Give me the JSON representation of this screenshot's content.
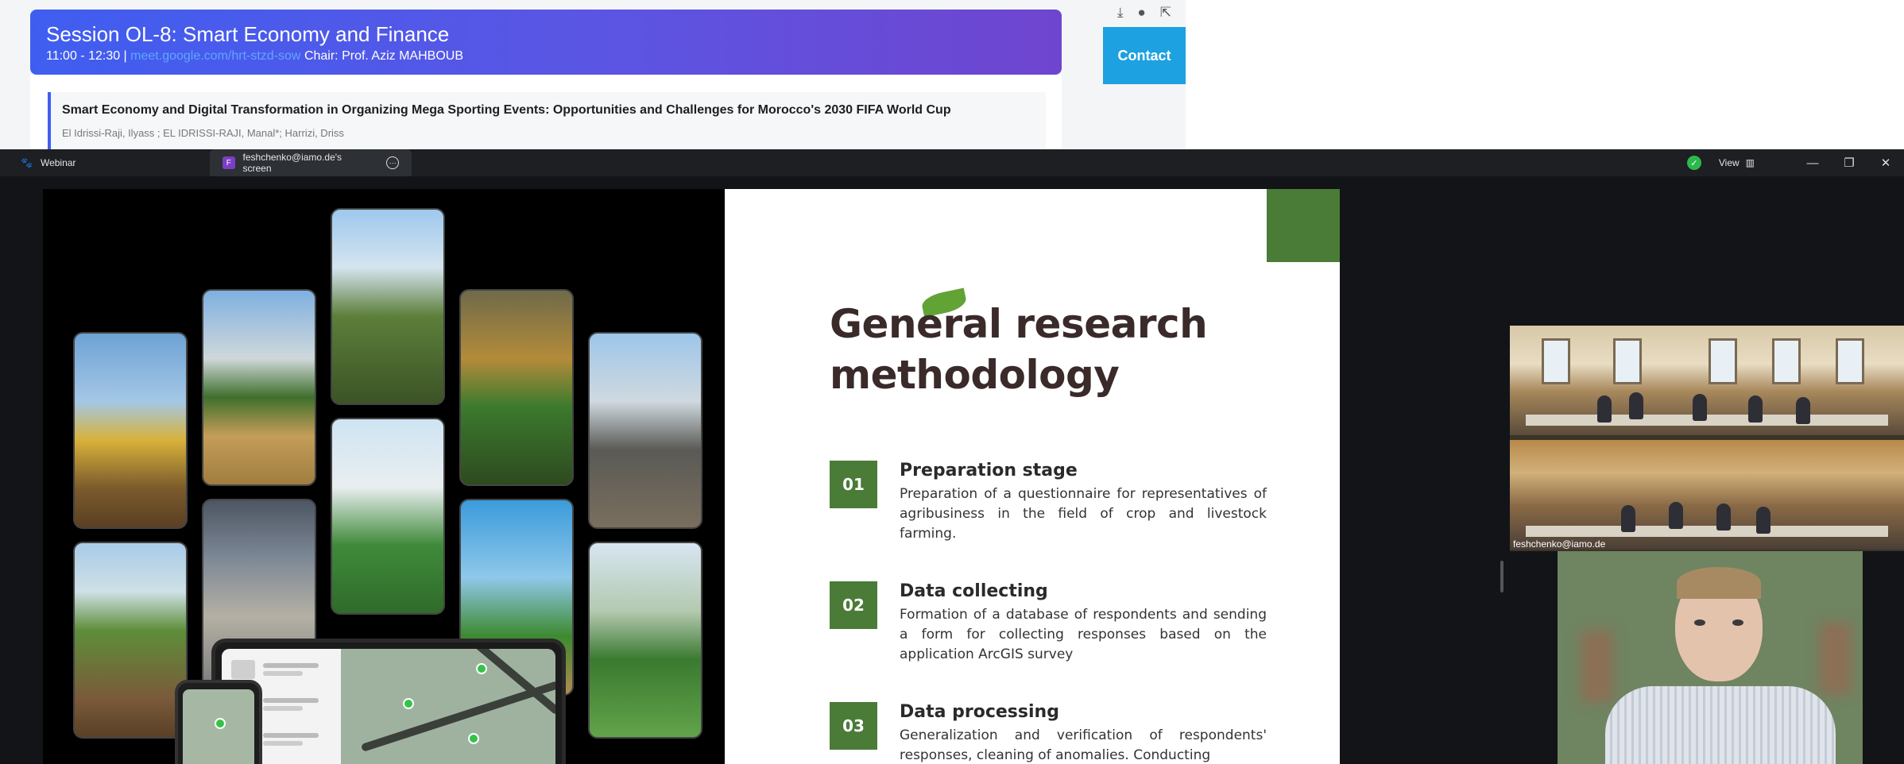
{
  "browser": {
    "session_title": "Session OL-8: Smart Economy and Finance",
    "session_time": "11:00 - 12:30 |",
    "meet_link": "meet.google.com/hrt-stzd-sow",
    "chair": "Chair: Prof. Aziz MAHBOUB",
    "paper_title": "Smart Economy and Digital Transformation in Organizing Mega Sporting Events: Opportunities and Challenges for Morocco's 2030 FIFA World Cup",
    "paper_authors": "El Idrissi-Raji, Ilyass ; EL IDRISSI-RAJI, Manal*; Harrizi, Driss",
    "contact_label": "Contact",
    "tools": [
      "download-icon",
      "info-icon",
      "share-icon"
    ]
  },
  "titlebar": {
    "app_tab": "Webinar",
    "screen_tab": "feshchenko@iamo.de's screen",
    "screen_badge": "F",
    "view_label": "View",
    "controls": [
      "minimize-icon",
      "restore-icon",
      "close-icon"
    ]
  },
  "slide": {
    "title_line1": "General research",
    "title_line2": "methodology",
    "accent_color": "#4a7b37",
    "steps": [
      {
        "num": "01",
        "title": "Preparation stage",
        "text": "Preparation of a questionnaire for representatives of agribusiness in the field of crop and livestock farming."
      },
      {
        "num": "02",
        "title": "Data collecting",
        "text": "Formation of a database of respondents and sending a form for collecting responses based on the application ArcGIS survey"
      },
      {
        "num": "03",
        "title": "Data processing",
        "text": "Generalization and verification of respondents' responses, cleaning of anomalies. Conducting"
      }
    ]
  },
  "participants": {
    "room_label": "feshchenko@iamo.de"
  }
}
